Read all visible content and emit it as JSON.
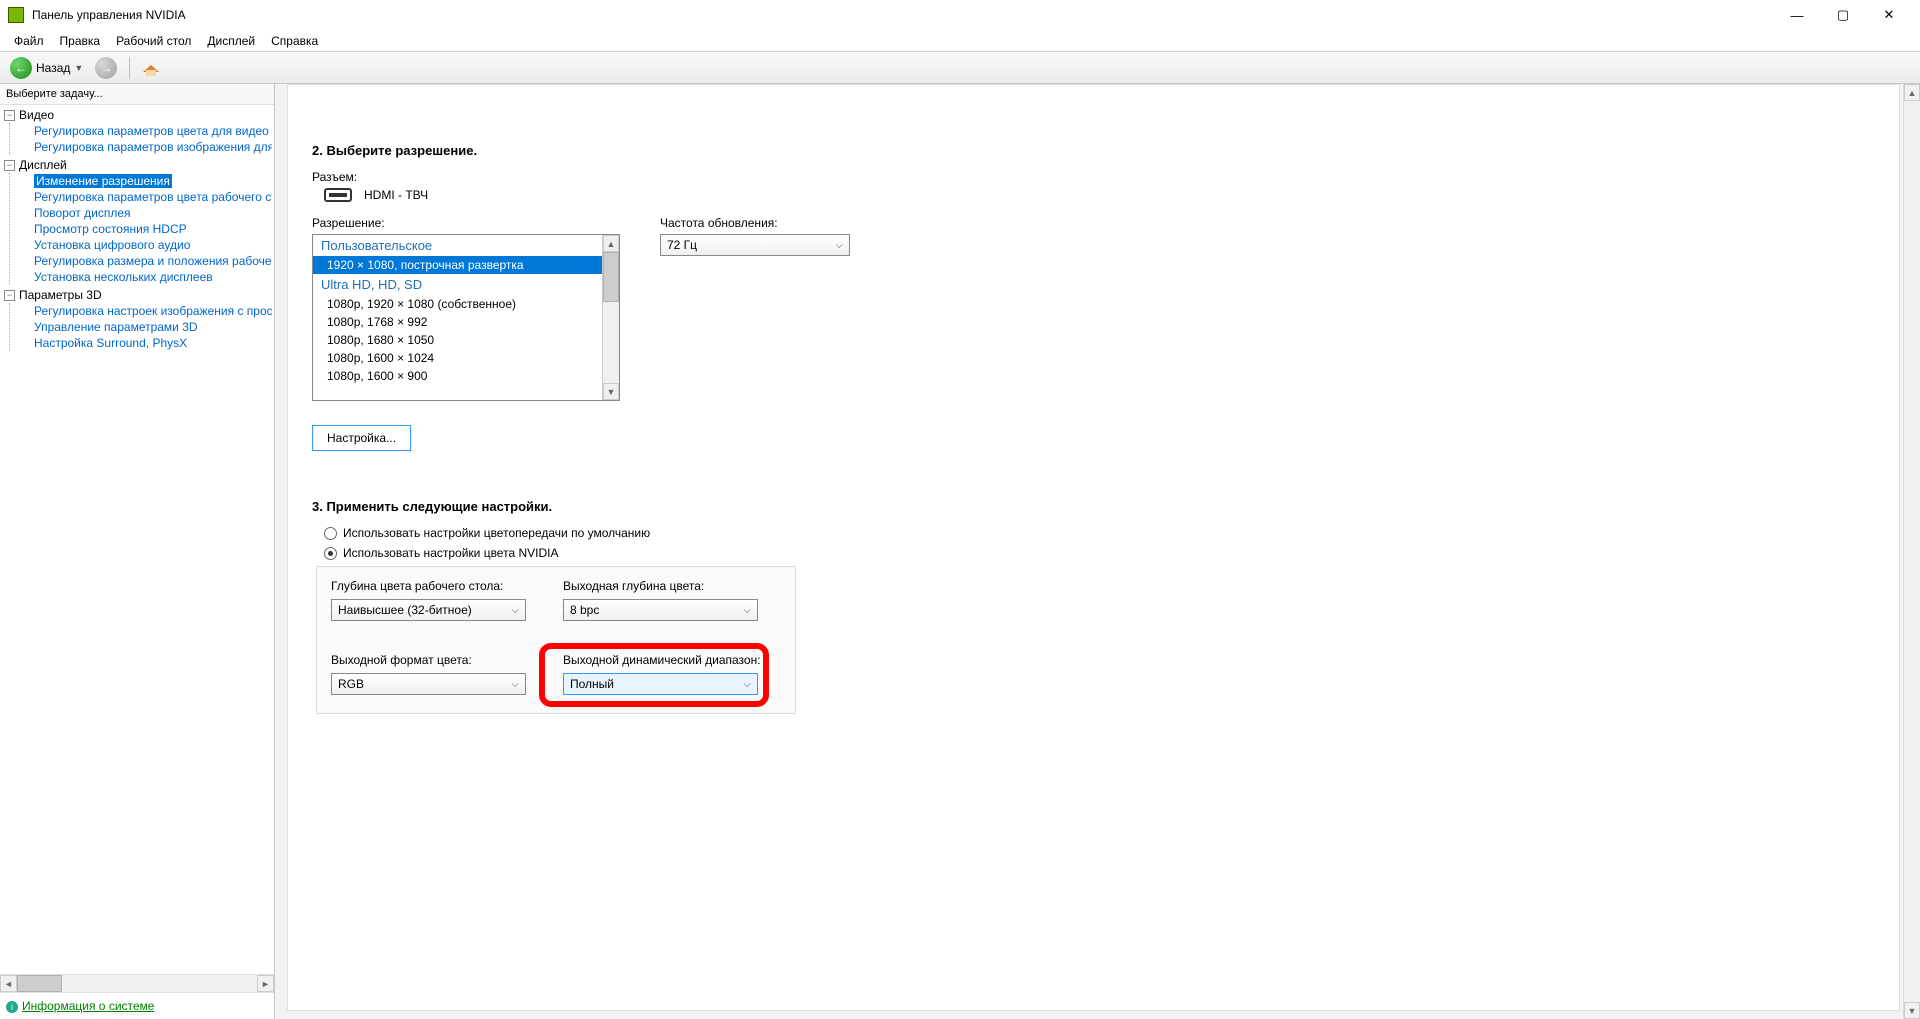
{
  "window": {
    "title": "Панель управления NVIDIA"
  },
  "menu": {
    "file": "Файл",
    "edit": "Правка",
    "desktop": "Рабочий стол",
    "display": "Дисплей",
    "help": "Справка"
  },
  "toolbar": {
    "back": "Назад"
  },
  "sidebar": {
    "header": "Выберите задачу...",
    "groups": [
      {
        "label": "Видео",
        "items": [
          "Регулировка параметров цвета для видео",
          "Регулировка параметров изображения для видео"
        ]
      },
      {
        "label": "Дисплей",
        "items": [
          "Изменение разрешения",
          "Регулировка параметров цвета рабочего стола",
          "Поворот дисплея",
          "Просмотр состояния HDCP",
          "Установка цифрового аудио",
          "Регулировка размера и положения рабочего стола",
          "Установка нескольких дисплеев"
        ]
      },
      {
        "label": "Параметры 3D",
        "items": [
          "Регулировка настроек изображения с просмотром",
          "Управление параметрами 3D",
          "Настройка Surround, PhysX"
        ]
      }
    ],
    "footer_link": "Информация о системе"
  },
  "content": {
    "section2_title": "2. Выберите разрешение.",
    "connector_label": "Разъем:",
    "connector_value": "HDMI - ТВЧ",
    "resolution_label": "Разрешение:",
    "refresh_label": "Частота обновления:",
    "refresh_value": "72 Гц",
    "reslist": {
      "group1": "Пользовательское",
      "g1_items": [
        "1920 × 1080, построчная развертка"
      ],
      "group2": "Ultra HD, HD, SD",
      "g2_items": [
        "1080p, 1920 × 1080 (собственное)",
        "1080p, 1768 × 992",
        "1080p, 1680 × 1050",
        "1080p, 1600 × 1024",
        "1080p, 1600 × 900"
      ]
    },
    "customize_btn": "Настройка...",
    "section3_title": "3. Применить следующие настройки.",
    "radio_default": "Использовать настройки цветопередачи по умолчанию",
    "radio_nvidia": "Использовать настройки цвета NVIDIA",
    "desktop_depth_label": "Глубина цвета рабочего стола:",
    "desktop_depth_value": "Наивысшее (32-битное)",
    "output_depth_label": "Выходная глубина цвета:",
    "output_depth_value": "8 bpc",
    "output_format_label": "Выходной формат цвета:",
    "output_format_value": "RGB",
    "dynamic_range_label": "Выходной динамический диапазон:",
    "dynamic_range_value": "Полный"
  }
}
